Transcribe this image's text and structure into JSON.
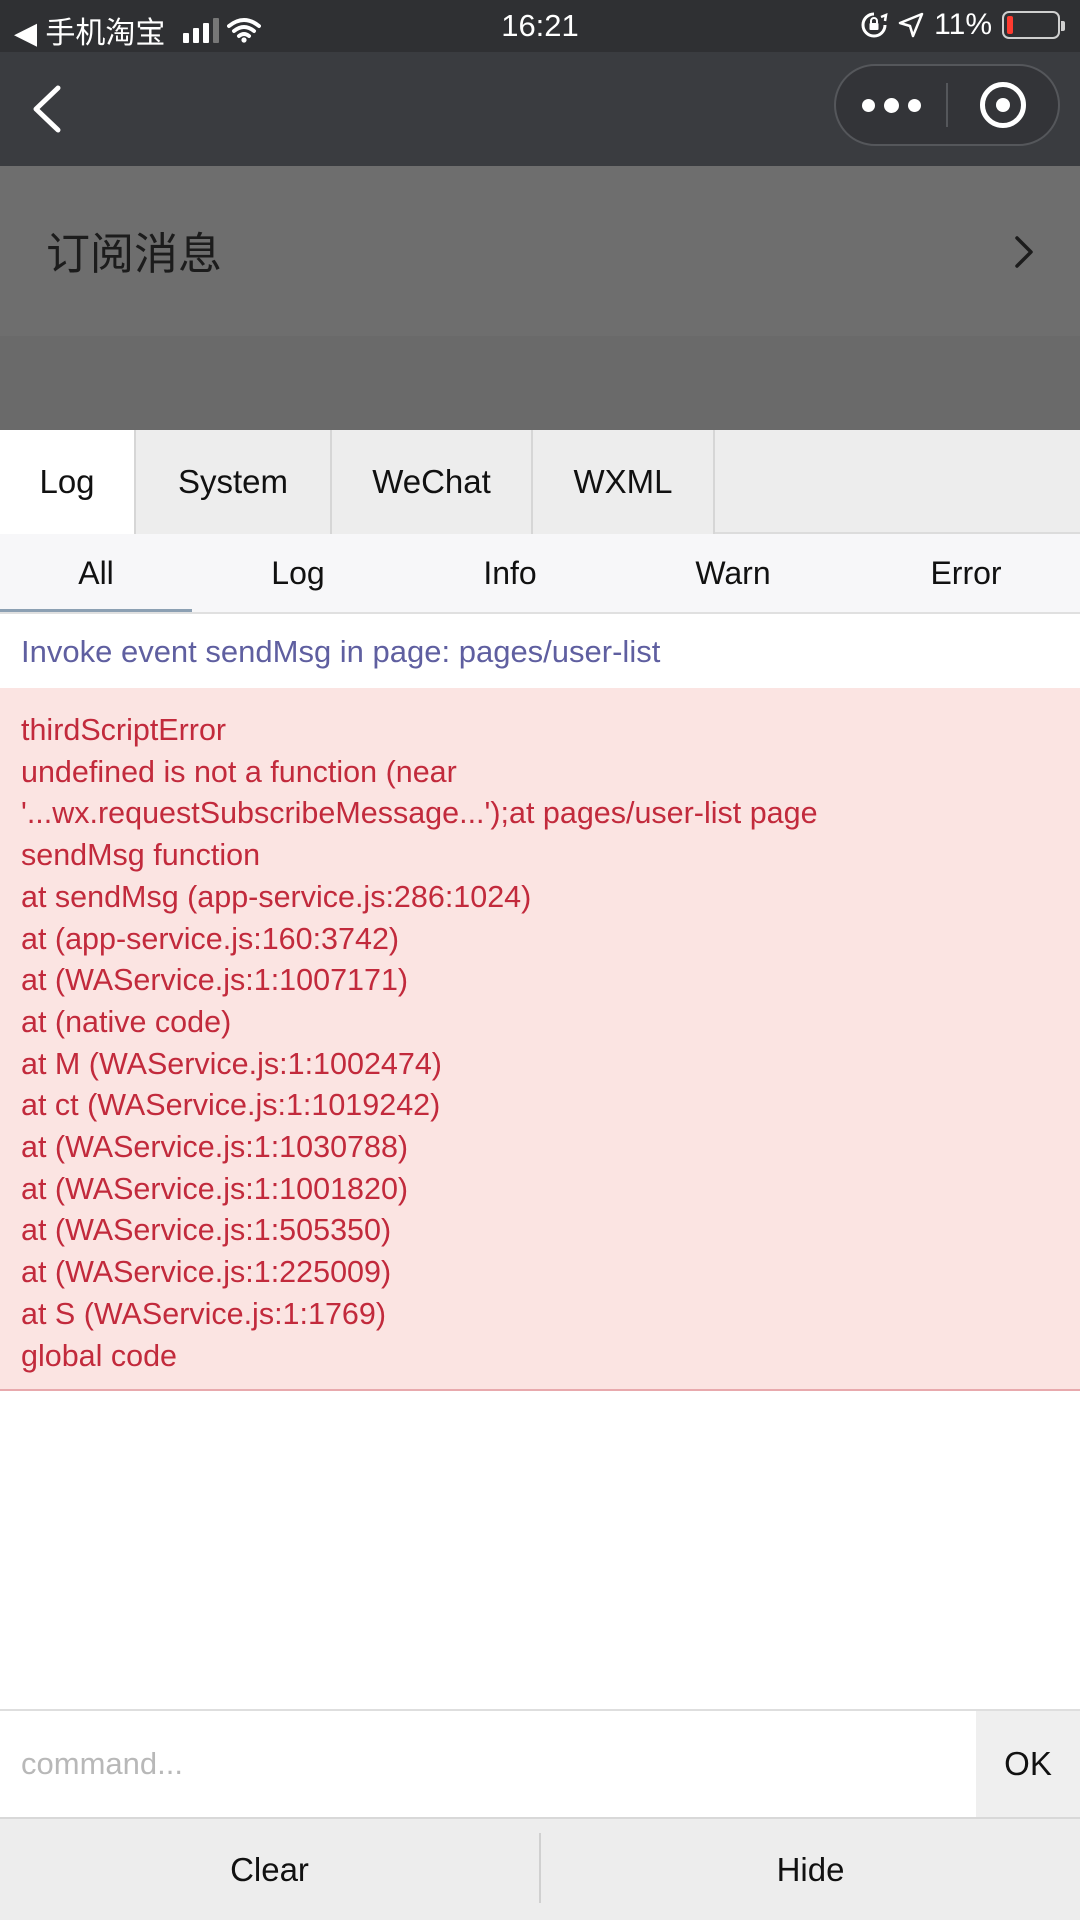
{
  "status_bar": {
    "carrier": "◀ 手机淘宝",
    "time": "16:21",
    "battery_percent": "11%",
    "battery_level": 0.11,
    "signal_bars": 3
  },
  "nav": {
    "back_icon": "chevron-left-icon",
    "more_icon": "more-dots-icon",
    "close_icon": "target-circle-icon"
  },
  "page": {
    "row_title": "订阅消息"
  },
  "console": {
    "tabs": [
      {
        "label": "Log",
        "active": true
      },
      {
        "label": "System",
        "active": false
      },
      {
        "label": "WeChat",
        "active": false
      },
      {
        "label": "WXML",
        "active": false
      }
    ],
    "filters": [
      {
        "label": "All",
        "active": true
      },
      {
        "label": "Log",
        "active": false
      },
      {
        "label": "Info",
        "active": false
      },
      {
        "label": "Warn",
        "active": false
      },
      {
        "label": "Error",
        "active": false
      }
    ],
    "info_line": "Invoke event sendMsg in page: pages/user-list",
    "error_lines": [
      "thirdScriptError",
      "undefined is not a function (near",
      "'...wx.requestSubscribeMessage...');at pages/user-list page",
      "sendMsg function",
      "at sendMsg (app-service.js:286:1024)",
      "at (app-service.js:160:3742)",
      "at (WAService.js:1:1007171)",
      "at (native code)",
      "at M (WAService.js:1:1002474)",
      "at ct (WAService.js:1:1019242)",
      "at (WAService.js:1:1030788)",
      "at (WAService.js:1:1001820)",
      "at (WAService.js:1:505350)",
      "at (WAService.js:1:225009)",
      "at S (WAService.js:1:1769)",
      "global code"
    ],
    "command_placeholder": "command...",
    "ok_label": "OK",
    "clear_label": "Clear",
    "hide_label": "Hide"
  },
  "colors": {
    "info_text": "#5f5fa0",
    "error_text": "#c22a3c",
    "error_bg": "#fbe4e2"
  }
}
